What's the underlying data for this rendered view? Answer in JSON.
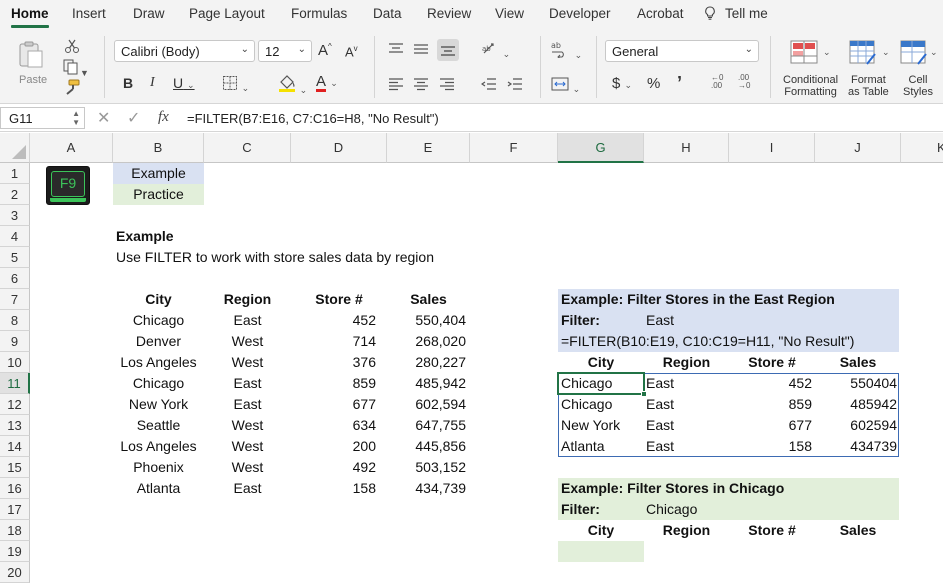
{
  "ribbon": {
    "tabs": [
      "Home",
      "Insert",
      "Draw",
      "Page Layout",
      "Formulas",
      "Data",
      "Review",
      "View",
      "Developer",
      "Acrobat",
      "Tell me"
    ],
    "paste_label": "Paste",
    "font_name": "Calibri (Body)",
    "font_size": "12",
    "grow_font": "A",
    "shrink_font": "A",
    "bold": "B",
    "italic": "I",
    "underline": "U",
    "font_color_letter": "A",
    "number_format": "General",
    "currency": "$",
    "percent": "%",
    "comma": "’",
    "conditional_formatting": [
      "Conditional",
      "Formatting"
    ],
    "format_as_table": [
      "Format",
      "as Table"
    ],
    "cell_styles": [
      "Cell",
      "Styles"
    ],
    "accent_color": "#217346"
  },
  "formula_bar": {
    "name_box": "G11",
    "fx": "fx",
    "formula": "=FILTER(B7:E16, C7:C16=H8, \"No Result\")"
  },
  "columns": [
    "A",
    "B",
    "C",
    "D",
    "E",
    "F",
    "G",
    "H",
    "I",
    "J",
    "K"
  ],
  "rows": [
    "1",
    "2",
    "3",
    "4",
    "5",
    "6",
    "7",
    "8",
    "9",
    "10",
    "11",
    "12",
    "13",
    "14",
    "15",
    "16",
    "17",
    "18",
    "19",
    "20"
  ],
  "sheet": {
    "f9_key": "F9",
    "b1": "Example",
    "b2": "Practice",
    "b4": "Example",
    "b5": "Use FILTER to work with store sales data by region",
    "data_headers": [
      "City",
      "Region",
      "Store #",
      "Sales"
    ],
    "data_rows": [
      [
        "Chicago",
        "East",
        "452",
        "550,404"
      ],
      [
        "Denver",
        "West",
        "714",
        "268,020"
      ],
      [
        "Los Angeles",
        "West",
        "376",
        "280,227"
      ],
      [
        "Chicago",
        "East",
        "859",
        "485,942"
      ],
      [
        "New York",
        "East",
        "677",
        "602,594"
      ],
      [
        "Seattle",
        "West",
        "634",
        "647,755"
      ],
      [
        "Los Angeles",
        "West",
        "200",
        "445,856"
      ],
      [
        "Phoenix",
        "West",
        "492",
        "503,152"
      ],
      [
        "Atlanta",
        "East",
        "158",
        "434,739"
      ]
    ],
    "example1": {
      "title": "Example: Filter Stores in the East Region",
      "filter_label": "Filter:",
      "filter_value": "East",
      "formula": "=FILTER(B10:E19, C10:C19=H11, \"No Result\")",
      "headers": [
        "City",
        "Region",
        "Store #",
        "Sales"
      ],
      "results": [
        [
          "Chicago",
          "East",
          "452",
          "550404"
        ],
        [
          "Chicago",
          "East",
          "859",
          "485942"
        ],
        [
          "New York",
          "East",
          "677",
          "602594"
        ],
        [
          "Atlanta",
          "East",
          "158",
          "434739"
        ]
      ]
    },
    "example2": {
      "title": "Example: Filter Stores in Chicago",
      "filter_label": "Filter:",
      "filter_value": "Chicago",
      "headers": [
        "City",
        "Region",
        "Store #",
        "Sales"
      ]
    }
  }
}
